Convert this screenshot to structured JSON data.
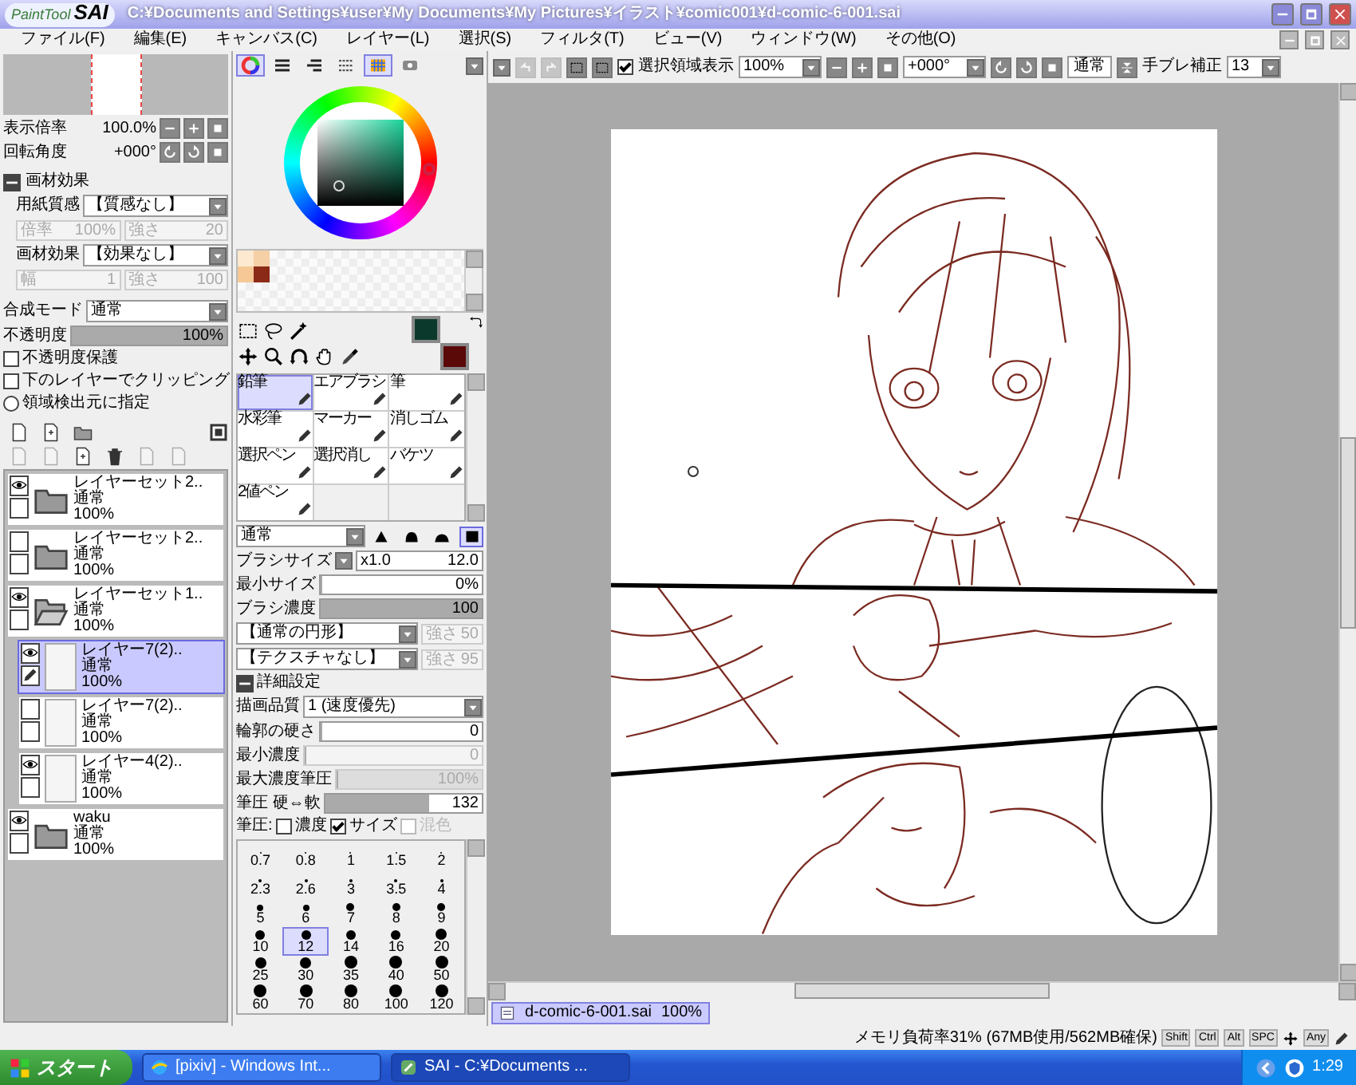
{
  "window": {
    "logo_small": "PaintTool",
    "logo_big": "SAI",
    "title": "C:¥Documents and Settings¥user¥My Documents¥My Pictures¥イラスト¥comic001¥d-comic-6-001.sai"
  },
  "menu": [
    "ファイル(F)",
    "編集(E)",
    "キャンバス(C)",
    "レイヤー(L)",
    "選択(S)",
    "フィルタ(T)",
    "ビュー(V)",
    "ウィンドウ(W)",
    "その他(O)"
  ],
  "navigator": {
    "zoom_label": "表示倍率",
    "zoom_value": "100.0%",
    "rotation_label": "回転角度",
    "rotation_value": "+000°"
  },
  "paper": {
    "heading": "画材効果",
    "expanded": true,
    "rows": [
      {
        "label": "用紙質感",
        "value": "【質感なし】",
        "params": [
          {
            "label": "倍率",
            "value": "100%",
            "disabled": true
          },
          {
            "label": "強さ",
            "value": "20",
            "disabled": true
          }
        ]
      },
      {
        "label": "画材効果",
        "value": "【効果なし】",
        "params": [
          {
            "label": "幅",
            "value": "1",
            "disabled": true
          },
          {
            "label": "強さ",
            "value": "100",
            "disabled": true
          }
        ]
      }
    ]
  },
  "blend": {
    "mode_label": "合成モード",
    "mode_value": "通常",
    "opacity_label": "不透明度",
    "opacity_value": "100%",
    "level": 1
  },
  "layer_options": [
    {
      "kind": "checkbox",
      "label": "不透明度保護",
      "checked": false
    },
    {
      "kind": "checkbox",
      "label": "下のレイヤーでクリッピング",
      "checked": false
    },
    {
      "kind": "radio",
      "label": "領域検出元に指定",
      "checked": false
    }
  ],
  "layers": [
    {
      "kind": "folder",
      "name": "レイヤーセット2..",
      "mode": "通常",
      "opacity": "100%",
      "visible": true,
      "expanded": false,
      "selected": false
    },
    {
      "kind": "folder",
      "name": "レイヤーセット2..",
      "mode": "通常",
      "opacity": "100%",
      "visible": false,
      "expanded": false,
      "selected": false
    },
    {
      "kind": "folder",
      "name": "レイヤーセット1..",
      "mode": "通常",
      "opacity": "100%",
      "visible": true,
      "expanded": true,
      "selected": false,
      "children": [
        {
          "kind": "layer",
          "name": "レイヤー7(2)..",
          "mode": "通常",
          "opacity": "100%",
          "visible": true,
          "selected": true
        },
        {
          "kind": "layer",
          "name": "レイヤー7(2)..",
          "mode": "通常",
          "opacity": "100%",
          "visible": false,
          "selected": false
        },
        {
          "kind": "layer",
          "name": "レイヤー4(2)..",
          "mode": "通常",
          "opacity": "100%",
          "visible": true,
          "selected": false
        }
      ]
    },
    {
      "kind": "folder",
      "name": "waku",
      "mode": "通常",
      "opacity": "100%",
      "visible": true,
      "expanded": false,
      "selected": false
    }
  ],
  "color_tabs": [
    {
      "kind": "wheel",
      "on": true
    },
    {
      "kind": "rgb",
      "on": false
    },
    {
      "kind": "hsv",
      "on": false
    },
    {
      "kind": "mixer",
      "on": false
    },
    {
      "kind": "swatches",
      "on": true
    },
    {
      "kind": "scratch",
      "on": false
    }
  ],
  "swatches": [
    {
      "color": "#fde8d0"
    },
    {
      "color": "#f5cfa5"
    },
    {
      "color": "#f6c895"
    },
    {
      "color": "#8c2a18"
    }
  ],
  "current_colors": [
    {
      "kind": "foreground",
      "color": "#0b3a2c"
    },
    {
      "kind": "background",
      "color": "#5a0808"
    }
  ],
  "brush_tools": [
    {
      "label": "鉛筆",
      "selected": true
    },
    {
      "label": "エアブラシ",
      "selected": false
    },
    {
      "label": "筆",
      "selected": false
    },
    {
      "label": "水彩筆",
      "selected": false
    },
    {
      "label": "マーカー",
      "selected": false
    },
    {
      "label": "消しゴム",
      "selected": false
    },
    {
      "label": "選択ペン",
      "selected": false
    },
    {
      "label": "選択消し",
      "selected": false
    },
    {
      "label": "バケツ",
      "selected": false
    },
    {
      "label": "2値ペン",
      "selected": false
    }
  ],
  "brush": {
    "mode_value": "通常",
    "tip_shapes": [
      {
        "selected": false
      },
      {
        "selected": false
      },
      {
        "selected": false
      },
      {
        "selected": true
      }
    ],
    "rows": [
      {
        "kind": "size",
        "label": "ブラシサイズ",
        "multiplier": "x1.0",
        "value": "12.0"
      },
      {
        "kind": "slider",
        "label": "最小サイズ",
        "value": "0%",
        "level": 0,
        "disabled": false
      },
      {
        "kind": "slider",
        "label": "ブラシ濃度",
        "value": "100",
        "level": 1,
        "disabled": false
      },
      {
        "kind": "select",
        "value": "【通常の円形】",
        "param_label": "強さ",
        "param_value": "50",
        "disabled": true
      },
      {
        "kind": "select",
        "value": "【テクスチャなし】",
        "param_label": "強さ",
        "param_value": "95",
        "disabled": true
      },
      {
        "kind": "heading",
        "label": "詳細設定",
        "expanded": true
      },
      {
        "kind": "labeled_select",
        "label": "描画品質",
        "value": "1 (速度優先)"
      },
      {
        "kind": "slider",
        "label": "輪郭の硬さ",
        "value": "0",
        "level": 0,
        "disabled": false
      },
      {
        "kind": "slider",
        "label": "最小濃度",
        "value": "0",
        "level": 0,
        "disabled": true
      },
      {
        "kind": "slider",
        "label": "最大濃度筆圧",
        "value": "100%",
        "level": 1,
        "disabled": true
      },
      {
        "kind": "slider",
        "label": "筆圧 硬⇔軟",
        "value": "132",
        "level": 0.66,
        "disabled": false
      },
      {
        "kind": "checks",
        "label": "筆圧:",
        "items": [
          {
            "label": "濃度",
            "checked": false,
            "disabled": false
          },
          {
            "label": "サイズ",
            "checked": true,
            "disabled": false
          },
          {
            "label": "混色",
            "checked": false,
            "disabled": true
          }
        ]
      }
    ]
  },
  "brush_sizes": [
    {
      "label": "0.7",
      "selected": false
    },
    {
      "label": "0.8",
      "selected": false
    },
    {
      "label": "1",
      "selected": false
    },
    {
      "label": "1.5",
      "selected": false
    },
    {
      "label": "2",
      "selected": false
    },
    {
      "label": "2.3",
      "selected": false
    },
    {
      "label": "2.6",
      "selected": false
    },
    {
      "label": "3",
      "selected": false
    },
    {
      "label": "3.5",
      "selected": false
    },
    {
      "label": "4",
      "selected": false
    },
    {
      "label": "5",
      "selected": false
    },
    {
      "label": "6",
      "selected": false
    },
    {
      "label": "7",
      "selected": false
    },
    {
      "label": "8",
      "selected": false
    },
    {
      "label": "9",
      "selected": false
    },
    {
      "label": "10",
      "selected": false
    },
    {
      "label": "12",
      "selected": true
    },
    {
      "label": "14",
      "selected": false
    },
    {
      "label": "16",
      "selected": false
    },
    {
      "label": "20",
      "selected": false
    },
    {
      "label": "25",
      "selected": false
    },
    {
      "label": "30",
      "selected": false
    },
    {
      "label": "35",
      "selected": false
    },
    {
      "label": "40",
      "selected": false
    },
    {
      "label": "50",
      "selected": false
    },
    {
      "label": "60",
      "selected": false
    },
    {
      "label": "70",
      "selected": false
    },
    {
      "label": "80",
      "selected": false
    },
    {
      "label": "100",
      "selected": false
    },
    {
      "label": "120",
      "selected": false
    }
  ],
  "canvas_toolbar": {
    "undo_disabled": true,
    "redo_disabled": true,
    "show_selection_label": "選択領域表示",
    "show_selection": true,
    "zoom": "100%",
    "angle": "+000°",
    "mode": "通常",
    "stabilizer_label": "手ブレ補正",
    "stabilizer": "13"
  },
  "documents": [
    {
      "name": "d-comic-6-001.sai",
      "zoom": "100%",
      "selected": true
    }
  ],
  "status": {
    "memory": "メモリ負荷率31% (67MB使用/562MB確保)",
    "indicators": [
      {
        "kind": "key",
        "label": "Shift"
      },
      {
        "kind": "key",
        "label": "Ctrl"
      },
      {
        "kind": "key",
        "label": "Alt"
      },
      {
        "kind": "key",
        "label": "SPC"
      },
      {
        "kind": "move"
      },
      {
        "kind": "key",
        "label": "Any"
      },
      {
        "kind": "pen"
      }
    ]
  },
  "taskbar": {
    "start": "スタート",
    "tasks": [
      {
        "label": "[pixiv] - Windows Int...",
        "kind": "browser",
        "selected": false
      },
      {
        "label": "SAI - C:¥Documents ...",
        "kind": "sai",
        "selected": true
      }
    ],
    "clock": "1:29"
  }
}
